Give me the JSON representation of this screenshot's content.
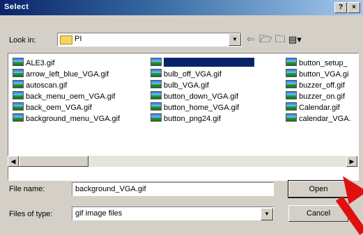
{
  "window": {
    "title": "Select"
  },
  "lookin": {
    "label": "Look in:",
    "value": "PI"
  },
  "files": {
    "col1": [
      "ALE3.gif",
      "arrow_left_blue_VGA.gif",
      "autoscan.gif",
      "back_menu_oem_VGA.gif",
      "back_oem_VGA.gif",
      "background_menu_VGA.gif"
    ],
    "col2": [
      "",
      "bulb_off_VGA.gif",
      "bulb_VGA.gif",
      "button_down_VGA.gif",
      "button_home_VGA.gif",
      "button_png24.gif"
    ],
    "col3": [
      "button_setup_",
      "button_VGA.gi",
      "buzzer_off.gif",
      "buzzer_on.gif",
      "Calendar.gif",
      "calendar_VGA."
    ]
  },
  "filename": {
    "label": "File name:",
    "value": "background_VGA.gif"
  },
  "filetype": {
    "label": "Files of type:",
    "value": "gif image files"
  },
  "buttons": {
    "open": "Open",
    "cancel": "Cancel",
    "help": "?",
    "close": "×"
  }
}
